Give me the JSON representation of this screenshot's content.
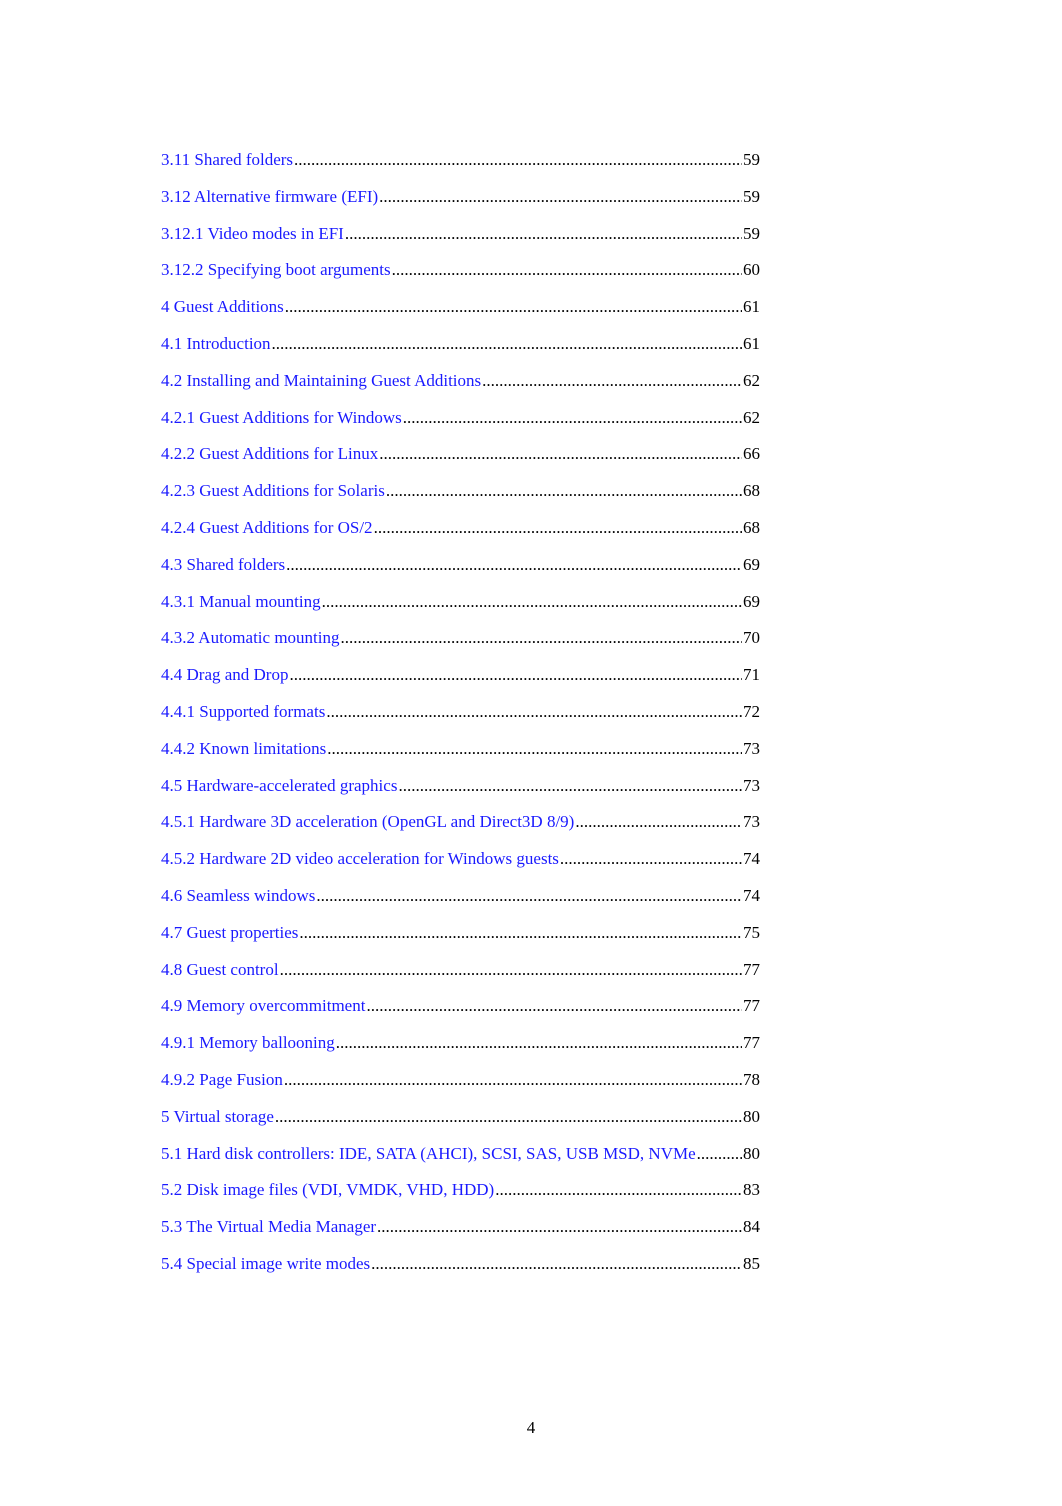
{
  "toc": {
    "entries": [
      {
        "title": "3.11 Shared folders",
        "page": "59"
      },
      {
        "title": "3.12 Alternative firmware (EFI)",
        "page": "59"
      },
      {
        "title": "3.12.1 Video modes in EFI",
        "page": "59"
      },
      {
        "title": "3.12.2 Specifying boot arguments",
        "page": "60"
      },
      {
        "title": "4 Guest Additions",
        "page": "61"
      },
      {
        "title": "4.1 Introduction",
        "page": "61"
      },
      {
        "title": "4.2 Installing and Maintaining Guest Additions",
        "page": "62"
      },
      {
        "title": "4.2.1 Guest Additions for Windows",
        "page": "62"
      },
      {
        "title": "4.2.2 Guest Additions for Linux",
        "page": "66"
      },
      {
        "title": "4.2.3 Guest Additions for Solaris",
        "page": "68"
      },
      {
        "title": "4.2.4 Guest Additions for OS/2",
        "page": "68"
      },
      {
        "title": "4.3 Shared folders",
        "page": "69"
      },
      {
        "title": "4.3.1 Manual mounting",
        "page": "69"
      },
      {
        "title": "4.3.2 Automatic mounting",
        "page": "70"
      },
      {
        "title": "4.4 Drag and Drop",
        "page": "71"
      },
      {
        "title": "4.4.1 Supported formats",
        "page": "72"
      },
      {
        "title": "4.4.2 Known limitations",
        "page": "73"
      },
      {
        "title": "4.5 Hardware-accelerated graphics",
        "page": "73"
      },
      {
        "title": "4.5.1 Hardware 3D acceleration (OpenGL and Direct3D 8/9)",
        "page": "73"
      },
      {
        "title": "4.5.2 Hardware 2D video acceleration for Windows guests",
        "page": "74"
      },
      {
        "title": "4.6 Seamless windows",
        "page": "74"
      },
      {
        "title": "4.7 Guest properties",
        "page": "75"
      },
      {
        "title": "4.8 Guest control",
        "page": "77"
      },
      {
        "title": "4.9 Memory overcommitment",
        "page": "77"
      },
      {
        "title": "4.9.1 Memory ballooning",
        "page": "77"
      },
      {
        "title": "4.9.2 Page Fusion",
        "page": "78"
      },
      {
        "title": "5 Virtual storage",
        "page": "80"
      },
      {
        "title": "5.1 Hard disk controllers: IDE, SATA (AHCI), SCSI, SAS, USB MSD, NVMe",
        "page": "80"
      },
      {
        "title": "5.2 Disk image files (VDI, VMDK, VHD, HDD)",
        "page": "83"
      },
      {
        "title": "5.3 The Virtual Media Manager",
        "page": "84"
      },
      {
        "title": "5.4 Special image write modes",
        "page": "85"
      }
    ]
  },
  "footer": {
    "page_number": "4"
  },
  "colors": {
    "link": "#1a1aff",
    "text": "#000000"
  }
}
